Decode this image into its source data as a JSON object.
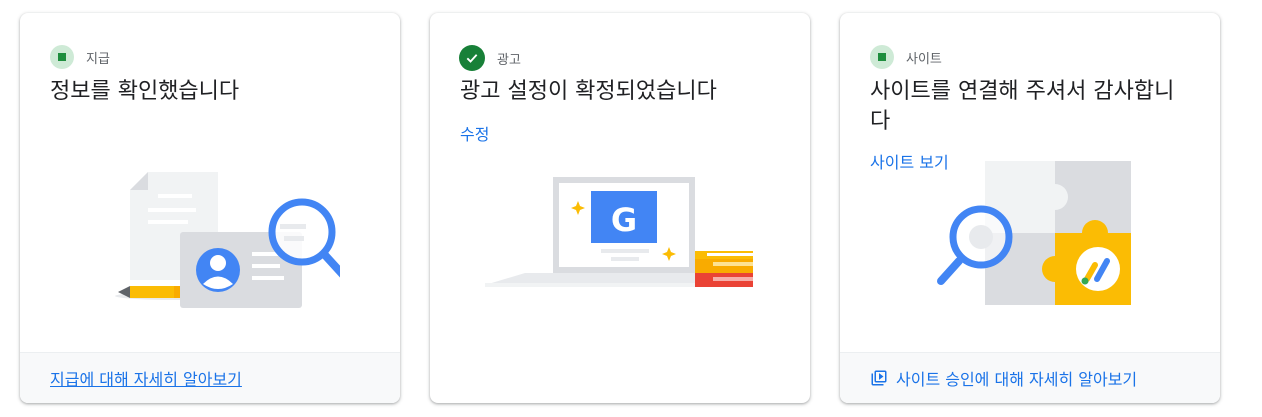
{
  "cards": [
    {
      "status_label": "지급",
      "status_kind": "pending",
      "title": "정보를 확인했습니다",
      "footer_link": "지급에 대해 자세히 알아보기"
    },
    {
      "status_label": "광고",
      "status_kind": "done",
      "title": "광고 설정이 확정되었습니다",
      "action_link": "수정",
      "illustration_letter": "G"
    },
    {
      "status_label": "사이트",
      "status_kind": "pending",
      "title": "사이트를 연결해 주셔서 감사합니다",
      "action_link": "사이트 보기",
      "footer_link": "사이트 승인에 대해 자세히 알아보기",
      "footer_icon": "video-library-icon"
    }
  ],
  "colors": {
    "accent": "#1a73e8",
    "status_done": "#188038",
    "status_pending_bg": "#ceead6",
    "status_pending_fg": "#1e8e3e",
    "google_blue": "#4285f4",
    "google_yellow": "#fbbc04",
    "google_red": "#ea4335",
    "google_green": "#34a853"
  }
}
